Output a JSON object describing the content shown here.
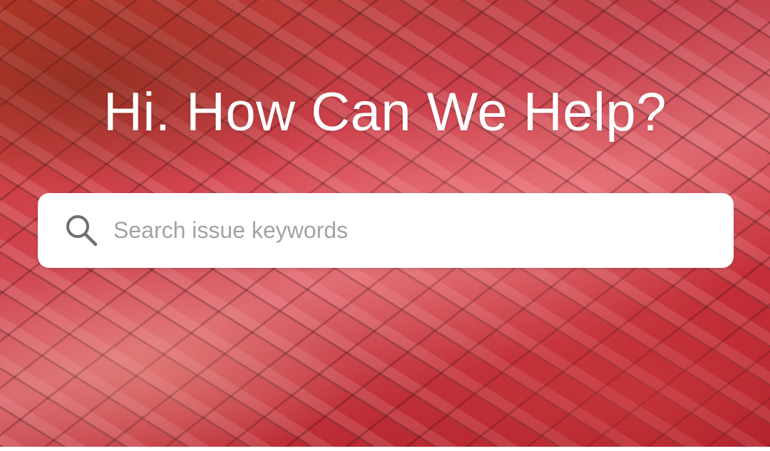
{
  "hero": {
    "headline": "Hi. How Can We Help?"
  },
  "search": {
    "placeholder": "Search issue keywords",
    "value": "",
    "icon": "search-icon"
  },
  "colors": {
    "headline_text": "#ffffff",
    "search_background": "#ffffff",
    "placeholder_text": "#a3a3a3",
    "icon_color": "#6f6f6f",
    "hero_base": "#c8303a"
  }
}
